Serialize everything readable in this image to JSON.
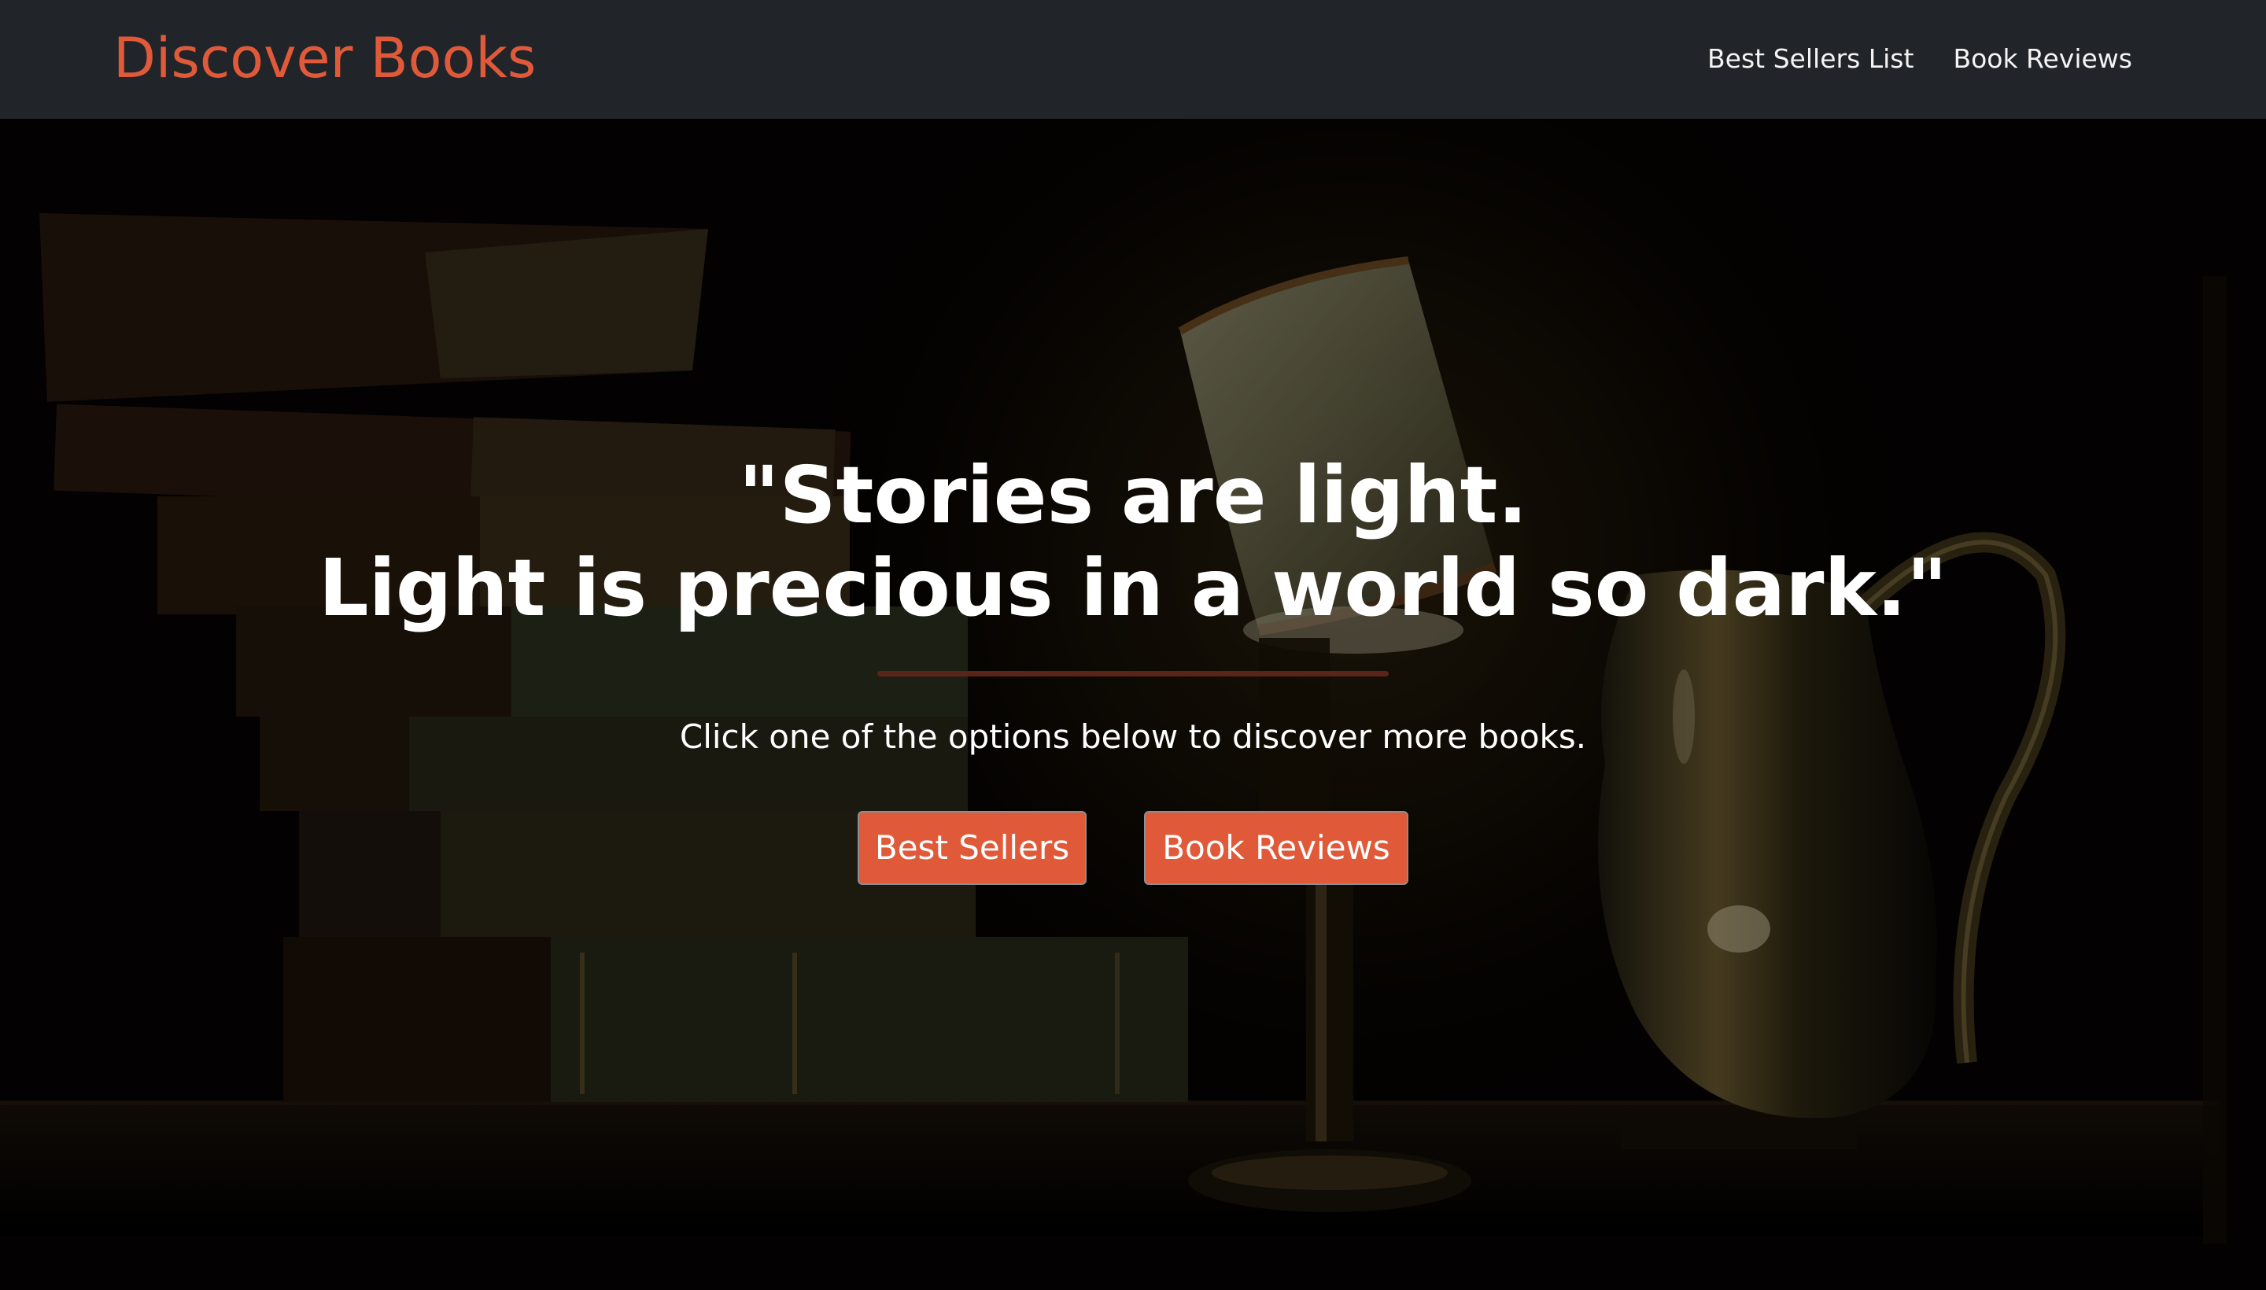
{
  "navbar": {
    "brand": "Discover Books",
    "links": [
      "Best Sellers List",
      "Book Reviews"
    ]
  },
  "hero": {
    "quote_line1": "\"Stories are light.",
    "quote_line2": "Light is precious in a world so dark.\"",
    "subtitle": "Click one of the options below to discover more books.",
    "buttons": {
      "best_sellers": "Best Sellers",
      "book_reviews": "Book Reviews"
    }
  },
  "colors": {
    "accent": "#e05a3a",
    "navbar_bg": "#212529",
    "page_bg": "#000000",
    "text": "#ffffff"
  }
}
